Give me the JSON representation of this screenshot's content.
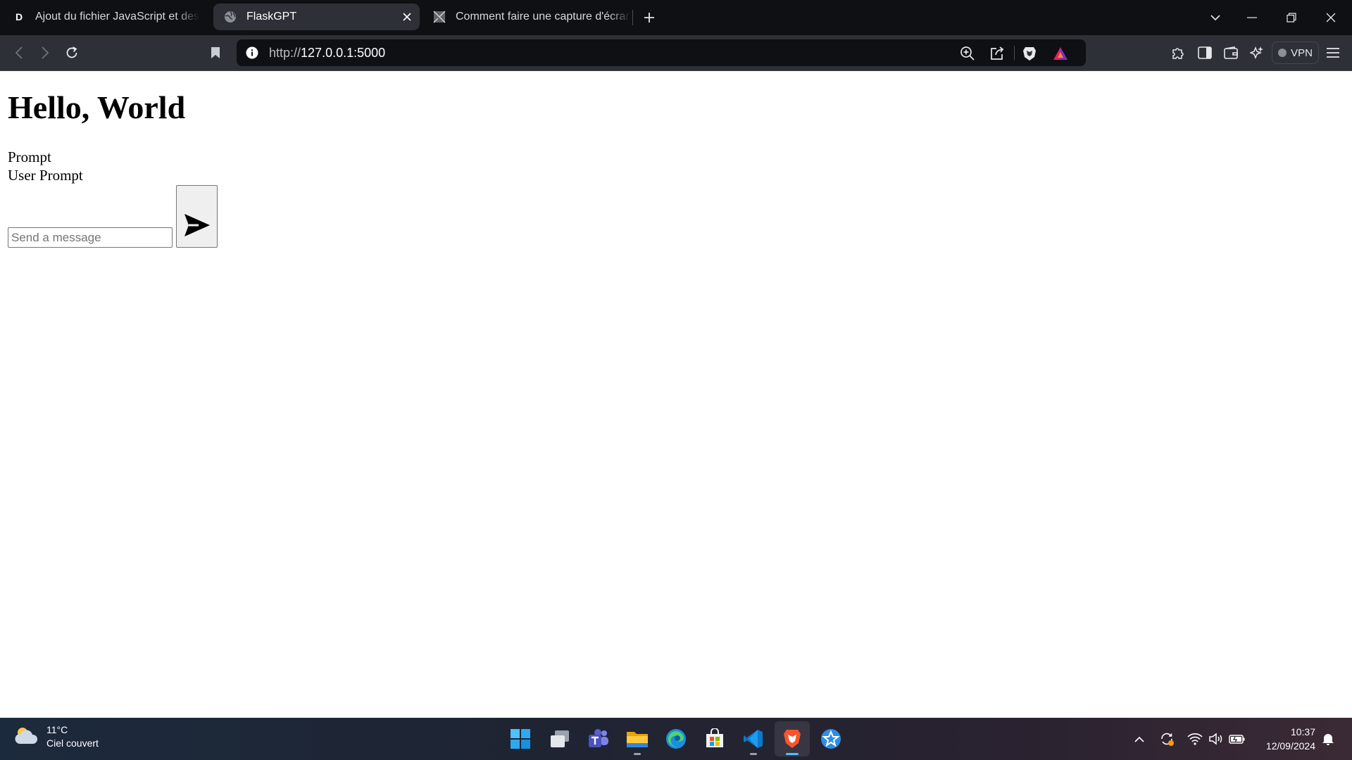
{
  "browser": {
    "tabs": [
      {
        "title": "Ajout du fichier JavaScript et des ba",
        "favicon": "letter-d-favicon",
        "favicon_letter": "D",
        "active": false
      },
      {
        "title": "FlaskGPT",
        "favicon": "globe-icon",
        "active": true
      },
      {
        "title": "Comment faire une capture d'écran",
        "favicon": "image-favicon",
        "active": false
      }
    ],
    "url": {
      "scheme": "http://",
      "host": "127.0.0.1:5000"
    },
    "vpn_label": "VPN"
  },
  "page": {
    "title": "Hello, World",
    "label_prompt": "Prompt",
    "label_user_prompt": "User Prompt",
    "input": {
      "placeholder": "Send a message",
      "value": ""
    },
    "send_icon": "send-arrow-icon"
  },
  "taskbar": {
    "weather": {
      "temperature": "11°C",
      "condition": "Ciel couvert"
    },
    "apps": [
      "windows-start-icon",
      "task-view-icon",
      "teams-icon",
      "file-explorer-icon",
      "edge-icon",
      "store-icon",
      "vscode-icon",
      "brave-icon",
      "app-icon"
    ],
    "clock": {
      "time": "10:37",
      "date": "12/09/2024"
    }
  },
  "colors": {
    "tab_strip_bg": "#0e1013",
    "toolbar_bg": "#2d3036",
    "urlbar_bg": "#0e1013",
    "brave_orange": "#fb542b",
    "taskbar_accent": "#4cc2ff"
  }
}
